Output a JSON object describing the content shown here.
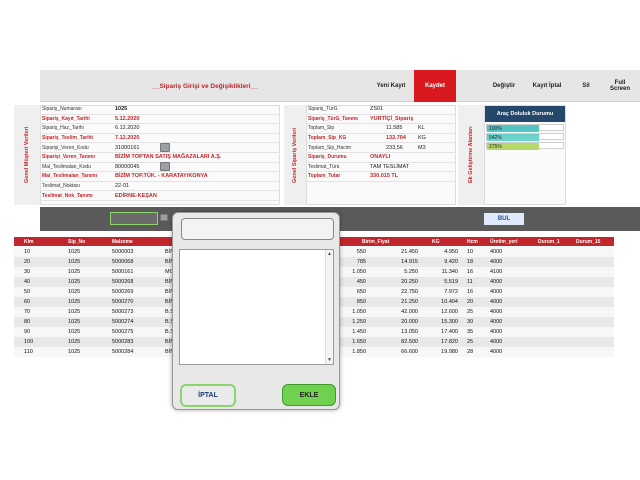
{
  "toolbar": {
    "title": "__Sipariş Girişi ve Değişiklikleri__",
    "yeni_kayit": "Yeni Kayıt",
    "kaydet": "Kaydet",
    "degistir": "Değiştir",
    "kayit_iptal": "Kayıt İptal",
    "sil": "Sil",
    "full_screen": "Full Screen"
  },
  "section_left": {
    "label": "Genel Müşteri Verileri",
    "fields": [
      {
        "label": "Sipariş_Numarası",
        "value": "1025"
      },
      {
        "label": "Sipariş_Kayıt_Tarihi",
        "value": "5.12.2020"
      },
      {
        "label": "Sipariş_Haz_Tarihi",
        "value": "6.12.2020"
      },
      {
        "label": "Sipariş_Teslim_Tarihi",
        "value": "7.12.2020"
      },
      {
        "label": "Siparişi_Veren_Kodu",
        "value": "31000161"
      },
      {
        "label": "Siparişi_Veren_Tanımı",
        "value": "BİZİM TOPTAN SATIŞ MAĞAZALARI A.Ş."
      },
      {
        "label": "Mal_Teslimalan_Kodu",
        "value": "80000045"
      },
      {
        "label": "Mal_Teslimalan_Tanımı",
        "value": "BİZİM TOP.TÜK. - KARATAY/KONYA"
      },
      {
        "label": "Teslimat_Noktası",
        "value": "22-01"
      },
      {
        "label": "Teslimat_Nok_Tanımı",
        "value": "EDİRNE-KEŞAN"
      }
    ]
  },
  "section_mid": {
    "label": "Genel Sipariş Verileri",
    "fields": [
      {
        "label": "Sipariş_TürG",
        "value": "ZS01",
        "unit": ""
      },
      {
        "label": "Sipariş_TürG_Tanımı",
        "value": "YURTİÇİ_Sipariş",
        "unit": ""
      },
      {
        "label": "Toplam_Sip",
        "value": "11.585",
        "unit": "KL"
      },
      {
        "label": "Toplam_Sip_KG",
        "value": "132.704",
        "unit": "KG"
      },
      {
        "label": "Toplam_Sip_Hacim",
        "value": "233,56",
        "unit": "M3"
      },
      {
        "label": "Sipariş_Durumu",
        "value": "ONAYLI",
        "unit": ""
      },
      {
        "label": "Teslimat_Türü",
        "value": "TAM TESLİMAT",
        "unit": ""
      },
      {
        "label": "Toplam_Tutar",
        "value": "330.015 TL",
        "unit": ""
      }
    ]
  },
  "section_right": {
    "label": "Ek Geliştirme Alanları",
    "doluluk_title": "Araç Doluluk Durumu",
    "bars": [
      {
        "label": "100%",
        "fill": 1.0,
        "color": "#57c4c4"
      },
      {
        "label": "542%",
        "fill": 1.0,
        "color": "#6ad2c9"
      },
      {
        "label": "275%",
        "fill": 1.0,
        "color": "#b6d86a"
      }
    ]
  },
  "search": {
    "bul_label": "BUL"
  },
  "table": {
    "columns": [
      "Klm",
      "Sip_No",
      "Malzeme",
      "",
      "Birim_Fiyat",
      "KG",
      "Hcm",
      "Üretim_yeri",
      "Durum_1",
      "Durum_15"
    ],
    "rows": [
      [
        "10",
        "1025",
        "5000003",
        "BİN",
        "550",
        "21.450",
        "4.950",
        "10",
        "4000"
      ],
      [
        "20",
        "1025",
        "5000068",
        "BİN",
        "785",
        "14.915",
        "9.420",
        "18",
        "4000"
      ],
      [
        "30",
        "1025",
        "5000161",
        "MC",
        "1.050",
        "5.250",
        "11.340",
        "16",
        "4100"
      ],
      [
        "40",
        "1025",
        "5000268",
        "BİN",
        "450",
        "20.250",
        "5.519",
        "11",
        "4000"
      ],
      [
        "50",
        "1025",
        "5000269",
        "BİN",
        "650",
        "22.750",
        "7.972",
        "16",
        "4000"
      ],
      [
        "60",
        "1025",
        "5000270",
        "BİN",
        "850",
        "21.250",
        "10.404",
        "20",
        "4000"
      ],
      [
        "70",
        "1025",
        "5000273",
        "B.S",
        "1.050",
        "42.000",
        "12.600",
        "25",
        "4000"
      ],
      [
        "80",
        "1025",
        "5000274",
        "B.S",
        "1.250",
        "20.000",
        "15.300",
        "30",
        "4000"
      ],
      [
        "90",
        "1025",
        "5000275",
        "B.S",
        "1.450",
        "13.050",
        "17.400",
        "35",
        "4000"
      ],
      [
        "100",
        "1025",
        "5000283",
        "BİN",
        "1.650",
        "82.500",
        "17.820",
        "25",
        "4000"
      ],
      [
        "110",
        "1025",
        "5000284",
        "BİN",
        "1.850",
        "66.600",
        "19.980",
        "28",
        "4000"
      ]
    ]
  },
  "modal": {
    "iptal_label": "İPTAL",
    "ekle_label": "EKLE",
    "scroll_up": "▲",
    "scroll_down": "▼"
  }
}
